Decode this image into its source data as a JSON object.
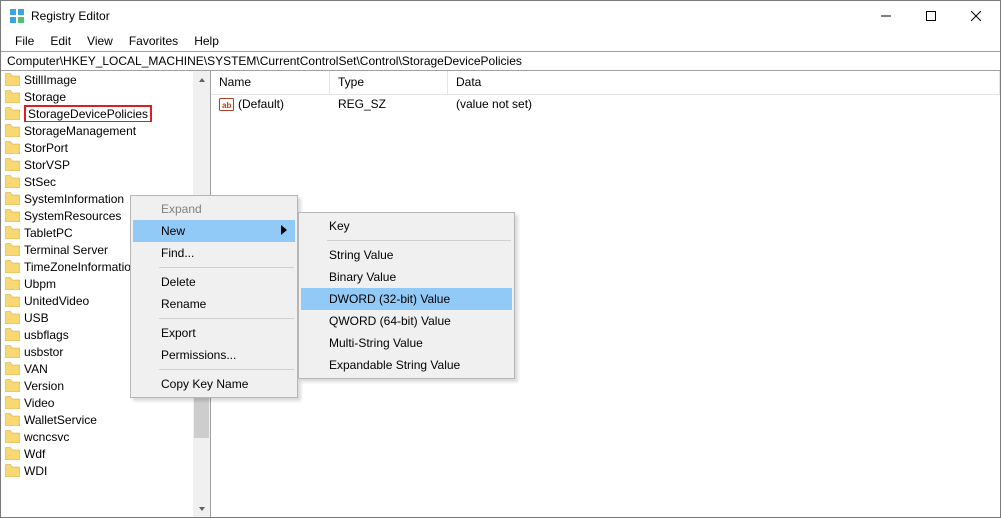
{
  "titlebar": {
    "title": "Registry Editor"
  },
  "menubar": {
    "file": "File",
    "edit": "Edit",
    "view": "View",
    "favorites": "Favorites",
    "help": "Help"
  },
  "addressbar": "Computer\\HKEY_LOCAL_MACHINE\\SYSTEM\\CurrentControlSet\\Control\\StorageDevicePolicies",
  "tree_items": [
    "StillImage",
    "Storage",
    "StorageDevicePolicies",
    "StorageManagement",
    "StorPort",
    "StorVSP",
    "StSec",
    "SystemInformation",
    "SystemResources",
    "TabletPC",
    "Terminal Server",
    "TimeZoneInformation",
    "Ubpm",
    "UnitedVideo",
    "USB",
    "usbflags",
    "usbstor",
    "VAN",
    "Version",
    "Video",
    "WalletService",
    "wcncsvc",
    "Wdf",
    "WDI"
  ],
  "tree_selected_index": 2,
  "list": {
    "headers": {
      "name": "Name",
      "type": "Type",
      "data": "Data"
    },
    "rows": [
      {
        "name": "(Default)",
        "type": "REG_SZ",
        "data": "(value not set)"
      }
    ]
  },
  "ctx1": {
    "expand": "Expand",
    "new": "New",
    "find": "Find...",
    "delete": "Delete",
    "rename": "Rename",
    "export": "Export",
    "permissions": "Permissions...",
    "copy_key_name": "Copy Key Name"
  },
  "ctx2": {
    "key": "Key",
    "string": "String Value",
    "binary": "Binary Value",
    "dword32": "DWORD (32-bit) Value",
    "qword64": "QWORD (64-bit) Value",
    "multi_string": "Multi-String Value",
    "expandable": "Expandable String Value"
  }
}
